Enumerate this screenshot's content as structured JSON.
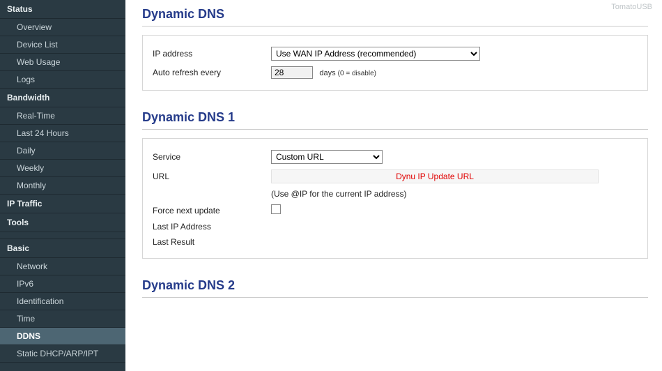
{
  "brand": "TomatoUSB",
  "sidebar": {
    "sections": [
      {
        "title": "Status",
        "items": [
          "Overview",
          "Device List",
          "Web Usage",
          "Logs"
        ],
        "active": null
      },
      {
        "title": "Bandwidth",
        "items": [
          "Real-Time",
          "Last 24 Hours",
          "Daily",
          "Weekly",
          "Monthly"
        ],
        "active": null
      },
      {
        "title": "IP Traffic",
        "items": [],
        "active": null
      },
      {
        "title": "Tools",
        "items": [],
        "active": null
      }
    ],
    "spaced_sections": [
      {
        "title": "Basic",
        "items": [
          "Network",
          "IPv6",
          "Identification",
          "Time",
          "DDNS",
          "Static DHCP/ARP/IPT"
        ],
        "active": "DDNS"
      }
    ]
  },
  "main": {
    "title1": "Dynamic DNS",
    "ip_label": "IP address",
    "ip_select": "Use WAN IP Address                    (recommended)",
    "refresh_label": "Auto refresh every",
    "refresh_value": "28",
    "refresh_suffix": "days",
    "refresh_note": "(0 = disable)",
    "title2": "Dynamic DNS 1",
    "service_label": "Service",
    "service_value": "Custom URL",
    "url_label": "URL",
    "url_value": "Dynu IP Update URL",
    "url_hint": "(Use @IP for the current IP address)",
    "force_label": "Force next update",
    "lastip_label": "Last IP Address",
    "lastresult_label": "Last Result",
    "title3": "Dynamic DNS 2"
  }
}
